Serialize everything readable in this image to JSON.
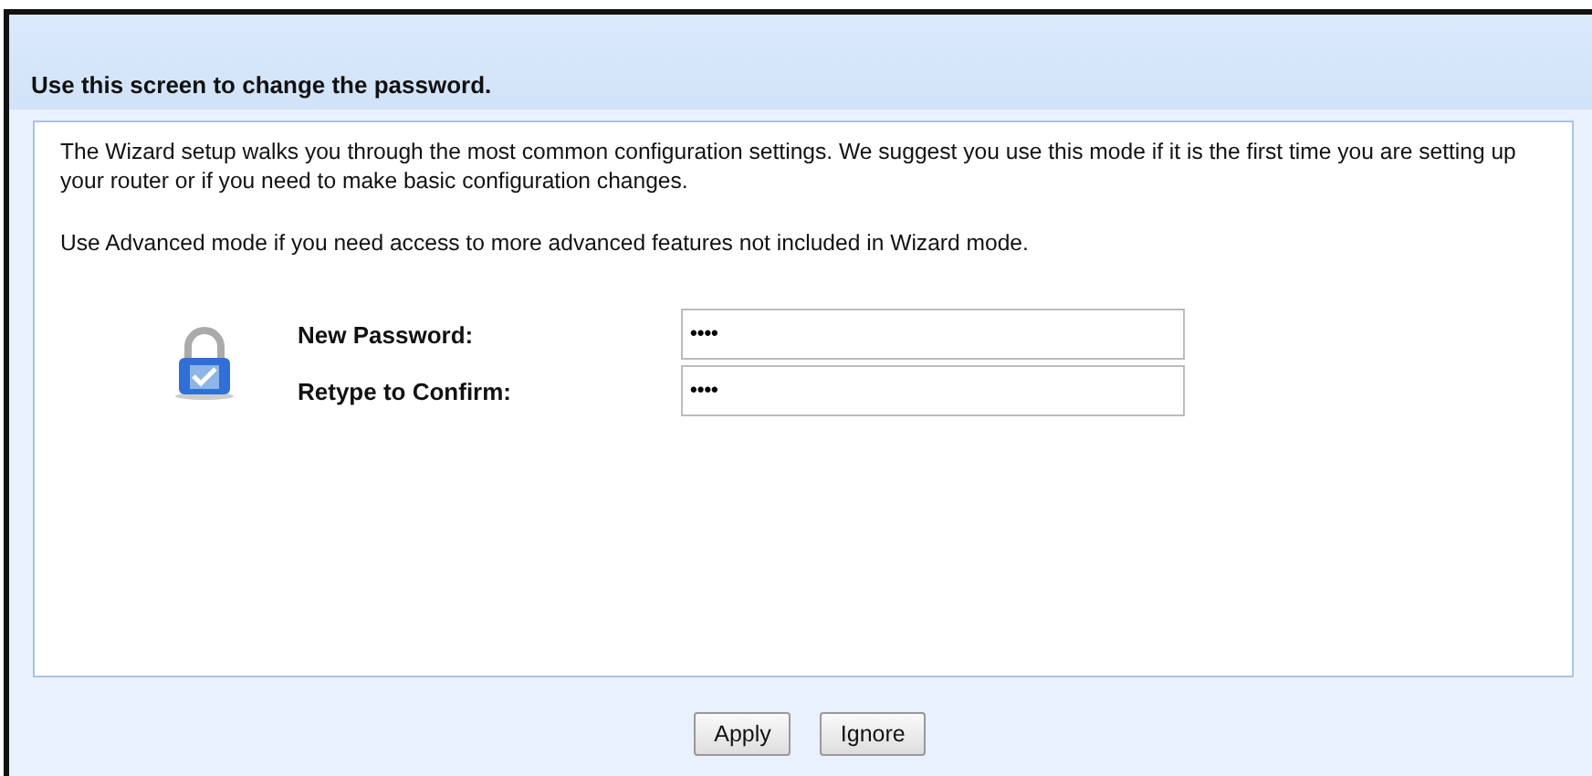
{
  "header": {
    "title": "Use this screen to change the password."
  },
  "paragraphs": [
    "The Wizard setup walks you through the most common configuration settings. We suggest you use this mode if it is the first time you are setting up your router or if you need to make basic configuration changes.",
    "Use Advanced mode if you need access to more advanced features not included in Wizard mode."
  ],
  "fields": [
    {
      "label": "New Password:",
      "value": "••••"
    },
    {
      "label": "Retype to Confirm:",
      "value": "••••"
    }
  ],
  "buttons": [
    "Apply",
    "Ignore"
  ]
}
